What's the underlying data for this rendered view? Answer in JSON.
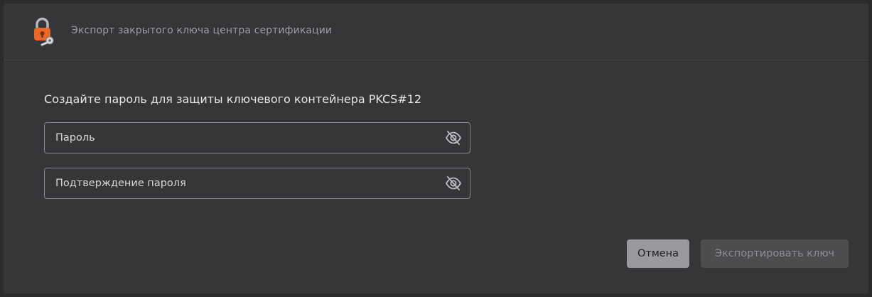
{
  "window": {
    "title": "Экспорт закрытого ключа центра сертификации",
    "app_icon": "padlock-with-key-icon"
  },
  "form": {
    "heading": "Создайте пароль для защиты ключевого контейнера PKCS#12",
    "password": {
      "value": "",
      "placeholder": "Пароль",
      "visibility_icon": "eye-slash-icon"
    },
    "confirm_password": {
      "value": "",
      "placeholder": "Подтверждение пароля",
      "visibility_icon": "eye-slash-icon"
    }
  },
  "buttons": {
    "cancel_label": "Отмена",
    "export_label": "Экспортировать ключ",
    "export_enabled": false
  },
  "colors": {
    "background": "#363638",
    "accent_orange": "#e8682a",
    "cancel_button": "#9a9a9e",
    "export_button_disabled": "#4d4d50"
  }
}
